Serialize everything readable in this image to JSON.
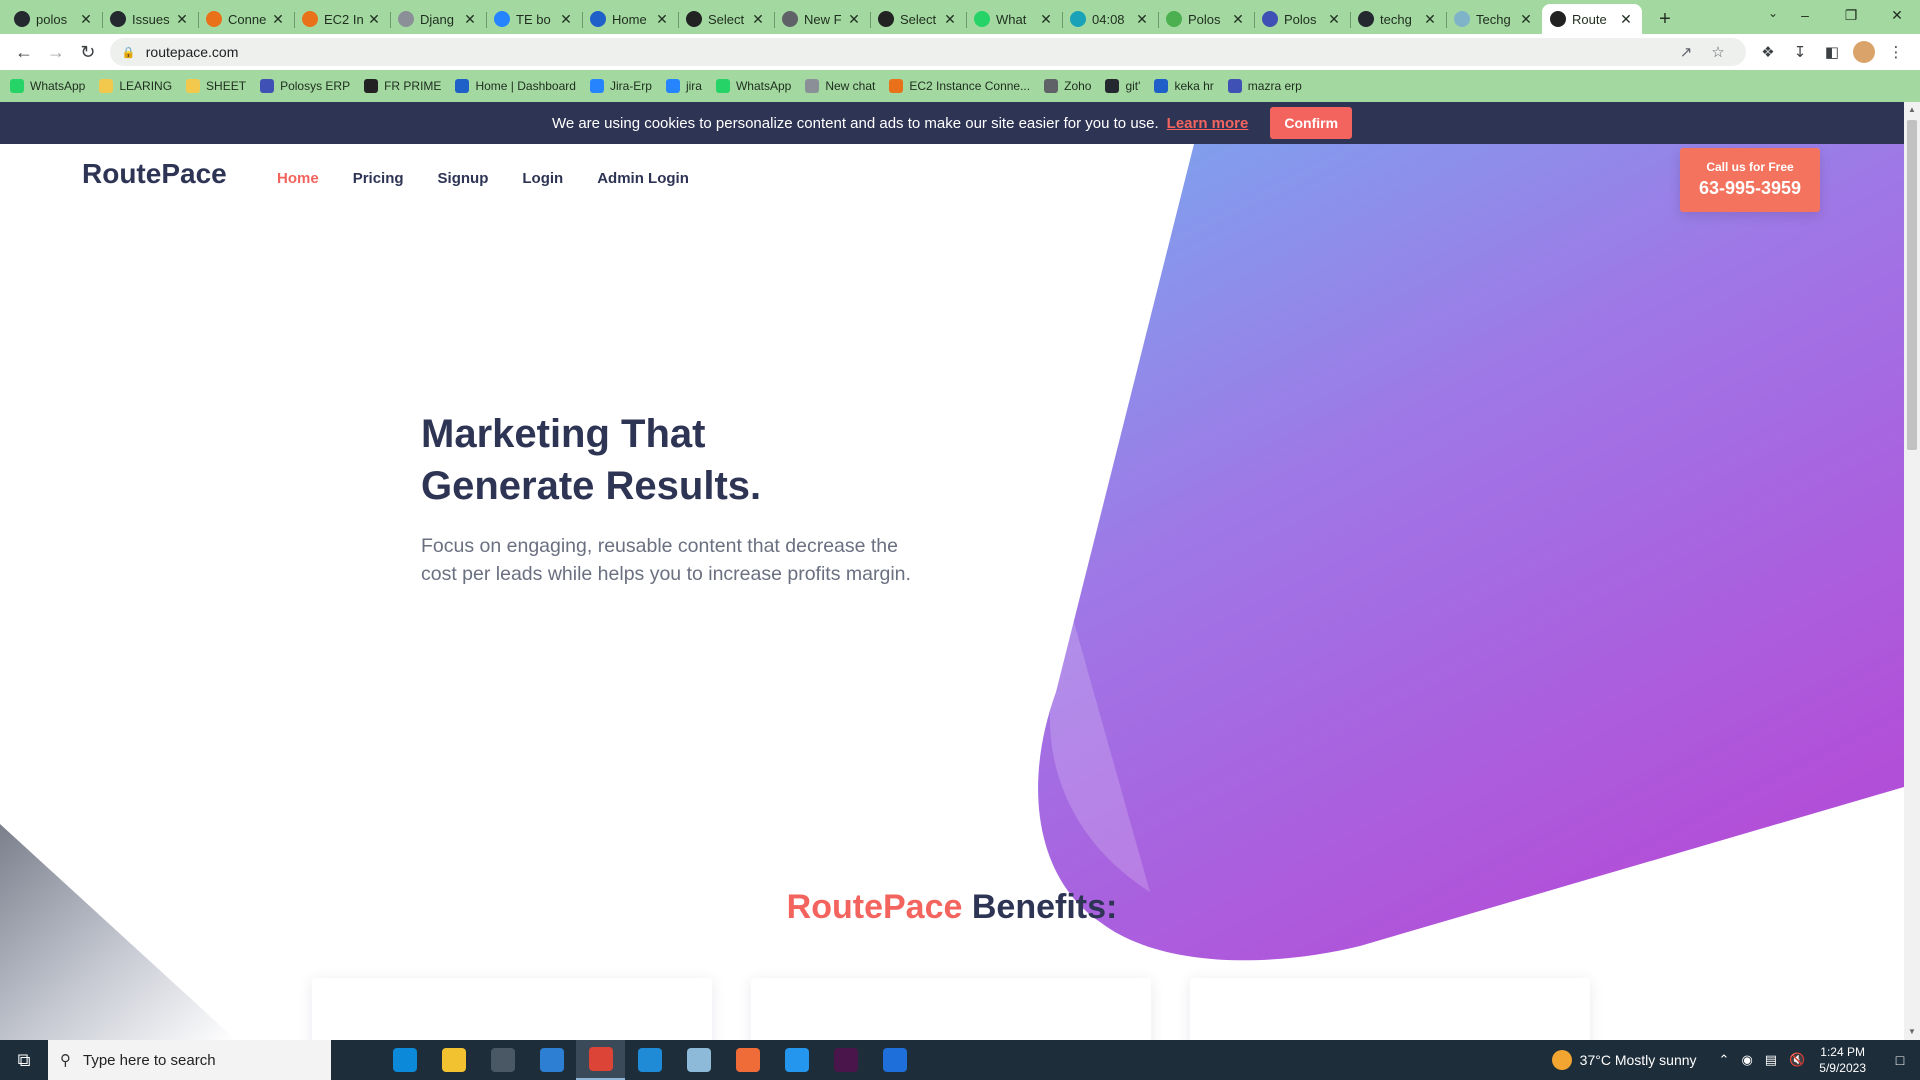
{
  "browser": {
    "tabs": [
      {
        "title": "polos",
        "icon": "github-icon",
        "color": "#24292f"
      },
      {
        "title": "Issues",
        "icon": "github-icon",
        "color": "#24292f"
      },
      {
        "title": "Conne",
        "icon": "pivot-icon",
        "color": "#e8711a"
      },
      {
        "title": "EC2 In",
        "icon": "aws-icon",
        "color": "#e8711a"
      },
      {
        "title": "Djang",
        "icon": "globe-icon",
        "color": "#8a8f98"
      },
      {
        "title": "TE bo",
        "icon": "jira-icon",
        "color": "#2684ff"
      },
      {
        "title": "Home",
        "icon": "keka-icon",
        "color": "#1f5fc8"
      },
      {
        "title": "Select",
        "icon": "globe-icon",
        "color": "#222222"
      },
      {
        "title": "New F",
        "icon": "form-icon",
        "color": "#5f6368"
      },
      {
        "title": "Select",
        "icon": "globe-icon",
        "color": "#222222"
      },
      {
        "title": "What",
        "icon": "whatsapp-icon",
        "color": "#25d366"
      },
      {
        "title": "04:08",
        "icon": "clock-icon",
        "color": "#1aa3b8"
      },
      {
        "title": "Polos",
        "icon": "polosys-icon",
        "color": "#4caf50"
      },
      {
        "title": "Polos",
        "icon": "polosys-icon",
        "color": "#3f51b5"
      },
      {
        "title": "techg",
        "icon": "github-icon",
        "color": "#24292f"
      },
      {
        "title": "Techg",
        "icon": "globe-icon",
        "color": "#7fb3c8"
      },
      {
        "title": "Route",
        "icon": "routepace-icon",
        "color": "#222222",
        "active": true
      }
    ],
    "url": "routepace.com",
    "bookmarks": [
      {
        "label": "WhatsApp",
        "icon": "whatsapp-icon",
        "color": "#25d366"
      },
      {
        "label": "LEARING",
        "icon": "folder-icon",
        "color": "#f2c94c"
      },
      {
        "label": "SHEET",
        "icon": "folder-icon",
        "color": "#f2c94c"
      },
      {
        "label": "Polosys ERP",
        "icon": "polosys-icon",
        "color": "#3f51b5"
      },
      {
        "label": "FR PRIME",
        "icon": "globe-icon",
        "color": "#222222"
      },
      {
        "label": "Home | Dashboard",
        "icon": "keka-icon",
        "color": "#1f5fc8"
      },
      {
        "label": "Jira-Erp",
        "icon": "jira-icon",
        "color": "#2684ff"
      },
      {
        "label": "jira",
        "icon": "jira-icon",
        "color": "#2684ff"
      },
      {
        "label": "WhatsApp",
        "icon": "whatsapp-icon",
        "color": "#25d366"
      },
      {
        "label": "New chat",
        "icon": "openai-icon",
        "color": "#8a8f98"
      },
      {
        "label": "EC2 Instance Conne...",
        "icon": "aws-icon",
        "color": "#e8711a"
      },
      {
        "label": "Zoho",
        "icon": "zoho-icon",
        "color": "#5f6368"
      },
      {
        "label": "git'",
        "icon": "github-icon",
        "color": "#24292f"
      },
      {
        "label": "keka hr",
        "icon": "keka-icon",
        "color": "#1f5fc8"
      },
      {
        "label": "mazra erp",
        "icon": "polosys-icon",
        "color": "#3f51b5"
      }
    ]
  },
  "page": {
    "cookie": {
      "text": "We are using cookies to personalize content and ads to make our site easier for you to use.",
      "link": "Learn more",
      "button": "Confirm"
    },
    "brand": "RoutePace",
    "nav": [
      {
        "label": "Home",
        "active": true
      },
      {
        "label": "Pricing"
      },
      {
        "label": "Signup"
      },
      {
        "label": "Login"
      },
      {
        "label": "Admin Login"
      }
    ],
    "call": {
      "label": "Call us for Free",
      "number": "63-995-3959"
    },
    "hero": {
      "title_line1": "Marketing That",
      "title_line2": "Generate Results.",
      "subtitle_line1": "Focus on engaging, reusable content that decrease the",
      "subtitle_line2": "cost per leads while helps you to increase profits margin."
    },
    "benefits": {
      "accent": "RoutePace",
      "rest": "Benefits:"
    },
    "colors": {
      "accent": "#f4645f",
      "dark": "#2e3454",
      "gradient_start": "#7ba6ee",
      "gradient_end": "#b24fd8"
    }
  },
  "taskbar": {
    "search_placeholder": "Type here to search",
    "apps": [
      {
        "icon": "task-view-icon",
        "color": "#1d2d3a"
      },
      {
        "icon": "edge-icon",
        "color": "#0c8ad9"
      },
      {
        "icon": "file-explorer-icon",
        "color": "#f2c230"
      },
      {
        "icon": "store-icon",
        "color": "#4a5866"
      },
      {
        "icon": "mail-icon",
        "color": "#2d7fd3"
      },
      {
        "icon": "chrome-icon",
        "color": "#db4437",
        "active": true
      },
      {
        "icon": "vscode-icon",
        "color": "#1f8ad6"
      },
      {
        "icon": "notepad-icon",
        "color": "#8cbad8"
      },
      {
        "icon": "postman-icon",
        "color": "#ef6b37"
      },
      {
        "icon": "docker-icon",
        "color": "#2496ed"
      },
      {
        "icon": "slack-icon",
        "color": "#4a154b"
      },
      {
        "icon": "calendar-icon",
        "color": "#1e6fd9"
      }
    ],
    "weather": "37°C  Mostly sunny",
    "time": "1:24 PM",
    "date": "5/9/2023"
  }
}
